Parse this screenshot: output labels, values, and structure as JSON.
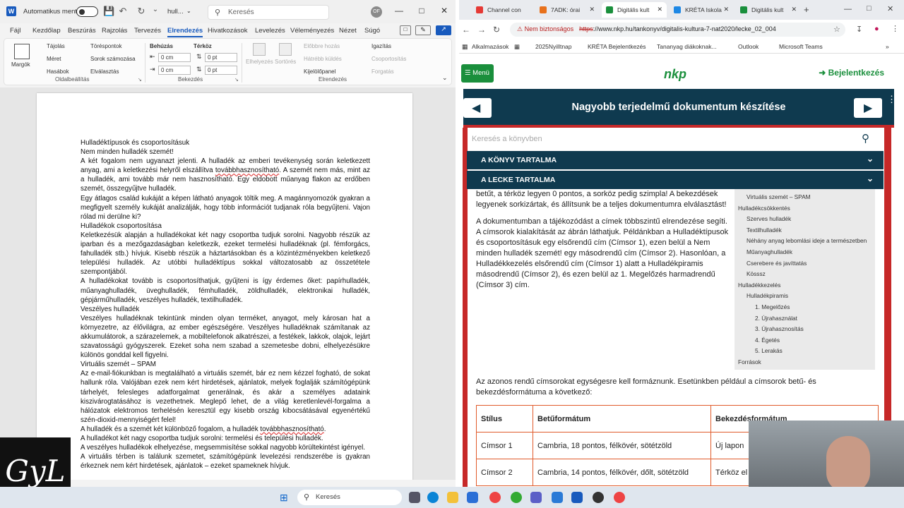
{
  "word": {
    "autosave_label": "Automatikus mentés",
    "doc_name": "hull...",
    "search_placeholder": "Keresés",
    "avatar_initials": "OF",
    "tabs": [
      "Fájl",
      "Kezdőlap",
      "Beszúrás",
      "Rajzolás",
      "Tervezés",
      "Elrendezés",
      "Hivatkozások",
      "Levelezés",
      "Véleményezés",
      "Nézet",
      "Súgó"
    ],
    "ribbon": {
      "margins": "Margók",
      "orientation": "Tájolás",
      "size": "Méret",
      "columns": "Hasábok",
      "breaks": "Töréspontok",
      "line_numbers": "Sorok számozása",
      "hyphenation": "Elválasztás",
      "group_page_setup": "Oldalbeállítás",
      "indent": "Behúzás",
      "spacing": "Térköz",
      "indent_left": "0 cm",
      "indent_right": "0 cm",
      "spacing_before": "0 pt",
      "spacing_after": "0 pt",
      "group_paragraph": "Bekezdés",
      "position": "Elhelyezés",
      "wrap": "Sortörés",
      "bring_forward": "Előbbre hozás",
      "send_backward": "Hátrébb küldés",
      "selection_pane": "Kijelölőpanel",
      "align": "Igazítás",
      "group": "Csoportosítás",
      "rotate": "Forgatás",
      "group_arrange": "Elrendezés"
    },
    "paragraphs": [
      {
        "text": "Hulladéktípusok és csoportosításuk",
        "heading": true
      },
      {
        "text": "Nem minden hulladék szemét!",
        "heading": true
      },
      {
        "text": "A két fogalom nem ugyanazt jelenti. A hulladék az emberi tevékenység során keletkezett anyag, ami a keletkezési helyről elszállítva továbbhasznosítható. A szemét nem más, mint az a hulladék, ami tovább már nem hasznosítható. Egy eldobott műanyag flakon az erdőben szemét, összegyűjtve hulladék."
      },
      {
        "text": "Egy átlagos család kukáját a képen látható anyagok töltik meg. A magánnyomozók gyakran a megfigyelt személy kukáját analizálják, hogy több információt tudjanak róla begyűjteni. Vajon rólad mi derülne ki?"
      },
      {
        "text": "Hulladékok csoportosítása",
        "heading": true
      },
      {
        "text": "Keletkezésük alapján a hulladékokat két nagy csoportba tudjuk sorolni. Nagyobb részük az iparban és a mezőgazdaságban keletkezik, ezeket termelési hulladéknak (pl. fémforgács, fahulladék stb.) hívjuk. Kisebb részük a háztartásokban és a közintézményekben keletkező települési hulladék. Az utóbbi hulladéktípus sokkal változatosabb az összetétele szempontjából."
      },
      {
        "text": "A hulladékokat tovább is csoportosíthatjuk, gyűjteni is így érdemes őket: papírhulladék, műanyaghulladék, üveghulladék, fémhulladék, zöldhulladék, elektronikai hulladék, gépjárműhulladék, veszélyes hulladék, textilhulladék."
      },
      {
        "text": "Veszélyes hulladék",
        "heading": true
      },
      {
        "text": "Veszélyes hulladéknak tekintünk minden olyan terméket, anyagot, mely károsan hat a környezetre, az élővilágra, az ember egészségére. Veszélyes hulladéknak számítanak az akkumulátorok, a szárazelemek, a mobiltelefonok alkatrészei, a festékek, lakkok, olajok, lejárt szavatosságú gyógyszerek. Ezeket soha nem szabad a szemetesbe dobni, elhelyezésükre különös gonddal kell figyelni."
      },
      {
        "text": "Virtuális szemét – SPAM",
        "heading": true
      },
      {
        "text": "Az e-mail-fiókunkban is megtalálható a virtuális szemét, bár ez nem kézzel fogható, de sokat hallunk róla. Valójában ezek nem kért hirdetések, ajánlatok, melyek foglalják számítógépünk tárhelyét, felesleges adatforgalmat generálnak, és akár a személyes adataink kiszivárogtatásához is vezethetnek. Meglepő lehet, de a világ keretlenlevél-forgalma a hálózatok elektromos terhelésén keresztül egy kisebb ország kibocsátásával egyenértékű szén-dioxid-mennyiségért felel!"
      },
      {
        "text": "A hulladék és a szemét két különböző fogalom, a hulladék továbbhasznosítható."
      },
      {
        "text": "A hulladékot két nagy csoportba tudjuk sorolni: termelési és települési hulladék."
      },
      {
        "text": "A veszélyes hulladékok elhelyezése, megsemmisítése sokkal nagyobb körültekintést igényel."
      },
      {
        "text": "A virtuális térben is találunk szemetet, számítógépünk levelezési rendszerébe is gyakran érkeznek nem kért hirdetések, ajánlatok – ezeket spameknek hívjuk."
      }
    ],
    "logo_text": "GyL"
  },
  "browser": {
    "tabs": [
      {
        "label": "Channel con",
        "color": "#e53935"
      },
      {
        "label": "7ADK: órai",
        "color": "#e8711c"
      },
      {
        "label": "Digitális kult",
        "color": "#1a8f3c",
        "active": true
      },
      {
        "label": "KRÉTA Iskola",
        "color": "#1e88e5"
      },
      {
        "label": "Digitális kult",
        "color": "#1a8f3c"
      }
    ],
    "insecure_label": "Nem biztonságos",
    "url_scheme": "https",
    "url_rest": "://www.nkp.hu/tankonyv/digitalis-kultura-7-nat2020/lecke_02_004",
    "bookmarks": [
      "Alkalmazások",
      "2025Nyilltnap",
      "KRÉTA Bejelentkezés",
      "Tananyag diákoknak...",
      "Outlook",
      "Microsoft Teams"
    ],
    "menu_label": "Menü",
    "logo": "nkp",
    "login": "Bejelentkezés",
    "lesson_title": "Nagyobb terjedelmű dokumentum készítése",
    "search_placeholder": "Keresés a könyvben",
    "acc_book": "A KÖNYV TARTALMA",
    "acc_lesson": "A LECKE TARTALMA",
    "content_p1": "betűt, a térköz legyen 0 pontos, a sorköz pedig szimpla! A bekezdések legyenek sorkizártak, és állítsunk be a teljes dokumentumra elválasztást!",
    "content_p2": "A dokumentumban a tájékozódást a címek többszintű elrendezése segíti. A címsorok kialakítását az ábrán láthatjuk. Példánkban a Hulladéktípusok és csoportosításuk egy elsőrendű cím (Címsor 1), ezen belül a Nem minden hulladék szemét! egy másodrendű cím (Címsor 2). Hasonlóan, a Hulladékkezelés elsőrendű cím (Címsor 1) alatt a Hulladékpiramis másodrendű (Címsor 2), és ezen belül az 1. Megelőzés harmadrendű (Címsor 3) cím.",
    "toc": [
      {
        "t": "Virtuális szemét – SPAM",
        "lvl": 2
      },
      {
        "t": "Hulladékcsökkentés",
        "lvl": 1
      },
      {
        "t": "Szerves hulladék",
        "lvl": 2
      },
      {
        "t": "Textilhulladék",
        "lvl": 2
      },
      {
        "t": "Néhány anyag lebomlási ideje a természetben",
        "lvl": 2
      },
      {
        "t": "Műanyaghulladék",
        "lvl": 2
      },
      {
        "t": "Cserebere és javíttatás",
        "lvl": 2
      },
      {
        "t": "Kösssz",
        "lvl": 2
      },
      {
        "t": "Hulladékkezelés",
        "lvl": 1
      },
      {
        "t": "Hulladékpiramis",
        "lvl": 2
      },
      {
        "t": "1. Megelőzés",
        "lvl": 3
      },
      {
        "t": "2. Újrahasználat",
        "lvl": 3
      },
      {
        "t": "3. Újrahasznosítás",
        "lvl": 3
      },
      {
        "t": "4. Égetés",
        "lvl": 3
      },
      {
        "t": "5. Lerakás",
        "lvl": 3
      },
      {
        "t": "Források",
        "lvl": 1
      }
    ],
    "content_p3": "Az azonos rendű címsorokat egységesre kell formáznunk. Esetünkben például a címsorok betű- és bekezdésformátuma a következő:",
    "table": {
      "headers": [
        "Stílus",
        "Betűformátum",
        "Bekezdésformátum"
      ],
      "rows": [
        [
          "Címsor 1",
          "Cambria, 18 pontos, félkövér, sötétzöld",
          "Új lapon"
        ],
        [
          "Címsor 2",
          "Cambria, 14 pontos, félkövér, dőlt, sötétzöld",
          "Térköz el"
        ]
      ]
    }
  },
  "taskbar": {
    "search_label": "Keresés"
  }
}
